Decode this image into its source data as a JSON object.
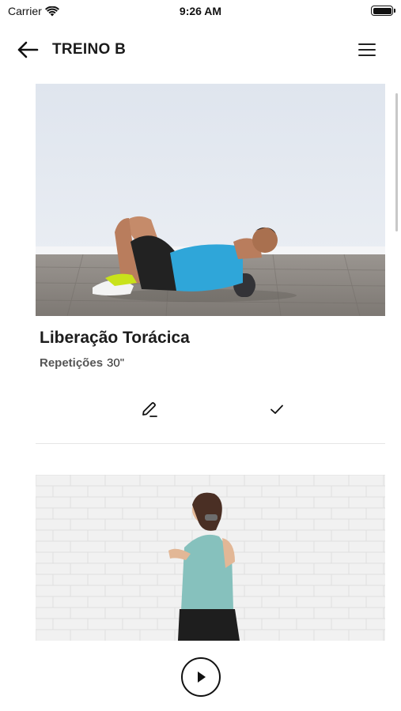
{
  "status_bar": {
    "carrier": "Carrier",
    "time": "9:26 AM",
    "battery_level": 1.0
  },
  "header": {
    "title": "TREINO B",
    "back_icon": "arrow-left-icon",
    "menu_icon": "hamburger-menu-icon"
  },
  "exercises": [
    {
      "name": "Liberação Torácica",
      "reps_label": "Repetições",
      "reps_value": "30\"",
      "image": "man-foam-roller-thoracic-photo",
      "edit_icon": "pencil-icon",
      "done_icon": "checkmark-icon"
    },
    {
      "image": "woman-shoulder-exercise-photo",
      "play_icon": "play-icon"
    }
  ],
  "colors": {
    "text": "#1a1a1a",
    "wall_1": "#e3e8ef",
    "floor_1": "#8a8580",
    "shirt_1": "#2fa6d9",
    "brick_wall_2": "#f1f1f1",
    "shirt_2": "#86c1bd"
  }
}
